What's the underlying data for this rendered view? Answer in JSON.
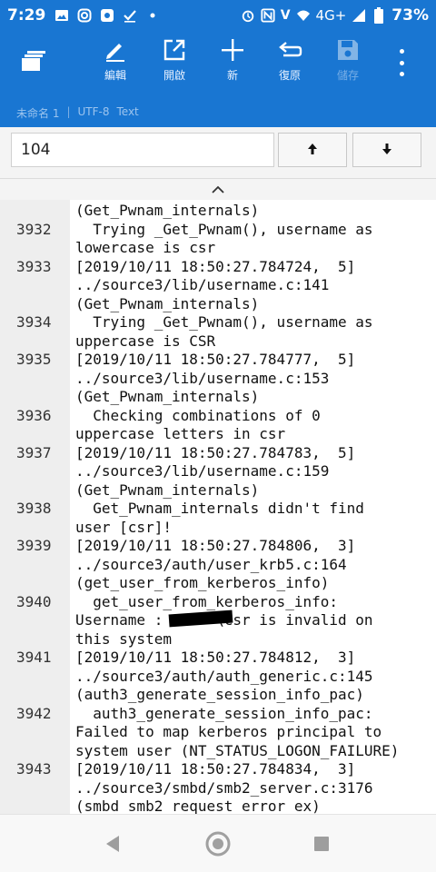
{
  "status_bar": {
    "time": "7:29",
    "notification_icons": [
      "image-icon",
      "instagram-icon",
      "app-icon",
      "check-icon",
      "dot-icon"
    ],
    "system_icons": [
      "alarm-icon",
      "nfc-icon",
      "volte-icon",
      "wifi-icon",
      "signal-icon",
      "battery-icon"
    ],
    "network_label": "4G+",
    "battery": "73%"
  },
  "toolbar": {
    "edit_label": "編輯",
    "open_label": "開啟",
    "new_label": "新",
    "undo_label": "復原",
    "save_label": "儲存"
  },
  "doc_info": {
    "filename": "未命名 1",
    "encoding": "UTF-8",
    "mode": "Text"
  },
  "search": {
    "value": "104",
    "prev_icon": "arrow-up-icon",
    "next_icon": "arrow-down-icon"
  },
  "editor": {
    "lines": [
      {
        "num": "",
        "text": "(Get_Pwnam_internals)"
      },
      {
        "num": "3932",
        "text": "  Trying _Get_Pwnam(), username as"
      },
      {
        "num": "",
        "text": "lowercase is csr"
      },
      {
        "num": "3933",
        "text": "[2019/10/11 18:50:27.784724,  5]"
      },
      {
        "num": "",
        "text": "../source3/lib/username.c:141"
      },
      {
        "num": "",
        "text": "(Get_Pwnam_internals)"
      },
      {
        "num": "3934",
        "text": "  Trying _Get_Pwnam(), username as"
      },
      {
        "num": "",
        "text": "uppercase is CSR"
      },
      {
        "num": "3935",
        "text": "[2019/10/11 18:50:27.784777,  5]"
      },
      {
        "num": "",
        "text": "../source3/lib/username.c:153"
      },
      {
        "num": "",
        "text": "(Get_Pwnam_internals)"
      },
      {
        "num": "3936",
        "text": "  Checking combinations of 0"
      },
      {
        "num": "",
        "text": "uppercase letters in csr"
      },
      {
        "num": "3937",
        "text": "[2019/10/11 18:50:27.784783,  5]"
      },
      {
        "num": "",
        "text": "../source3/lib/username.c:159"
      },
      {
        "num": "",
        "text": "(Get_Pwnam_internals)"
      },
      {
        "num": "3938",
        "text": "  Get_Pwnam_internals didn't find"
      },
      {
        "num": "",
        "text": "user [csr]!"
      },
      {
        "num": "3939",
        "text": "[2019/10/11 18:50:27.784806,  3]"
      },
      {
        "num": "",
        "text": "../source3/auth/user_krb5.c:164"
      },
      {
        "num": "",
        "text": "(get_user_from_kerberos_info)"
      },
      {
        "num": "3940",
        "text": "  get_user_from_kerberos_info:"
      },
      {
        "num": "",
        "text": "Username :      \\csr is invalid on"
      },
      {
        "num": "",
        "text": "this system"
      },
      {
        "num": "3941",
        "text": "[2019/10/11 18:50:27.784812,  3]"
      },
      {
        "num": "",
        "text": "../source3/auth/auth_generic.c:145"
      },
      {
        "num": "",
        "text": "(auth3_generate_session_info_pac)"
      },
      {
        "num": "3942",
        "text": "  auth3_generate_session_info_pac:"
      },
      {
        "num": "",
        "text": "Failed to map kerberos principal to"
      },
      {
        "num": "",
        "text": "system user (NT_STATUS_LOGON_FAILURE)"
      },
      {
        "num": "3943",
        "text": "[2019/10/11 18:50:27.784834,  3]"
      },
      {
        "num": "",
        "text": "../source3/smbd/smb2_server.c:3176"
      },
      {
        "num": "",
        "text": "(smbd_smb2_request_error_ex)"
      }
    ]
  },
  "colors": {
    "primary": "#1976d2",
    "gutter": "#eeeeee"
  }
}
